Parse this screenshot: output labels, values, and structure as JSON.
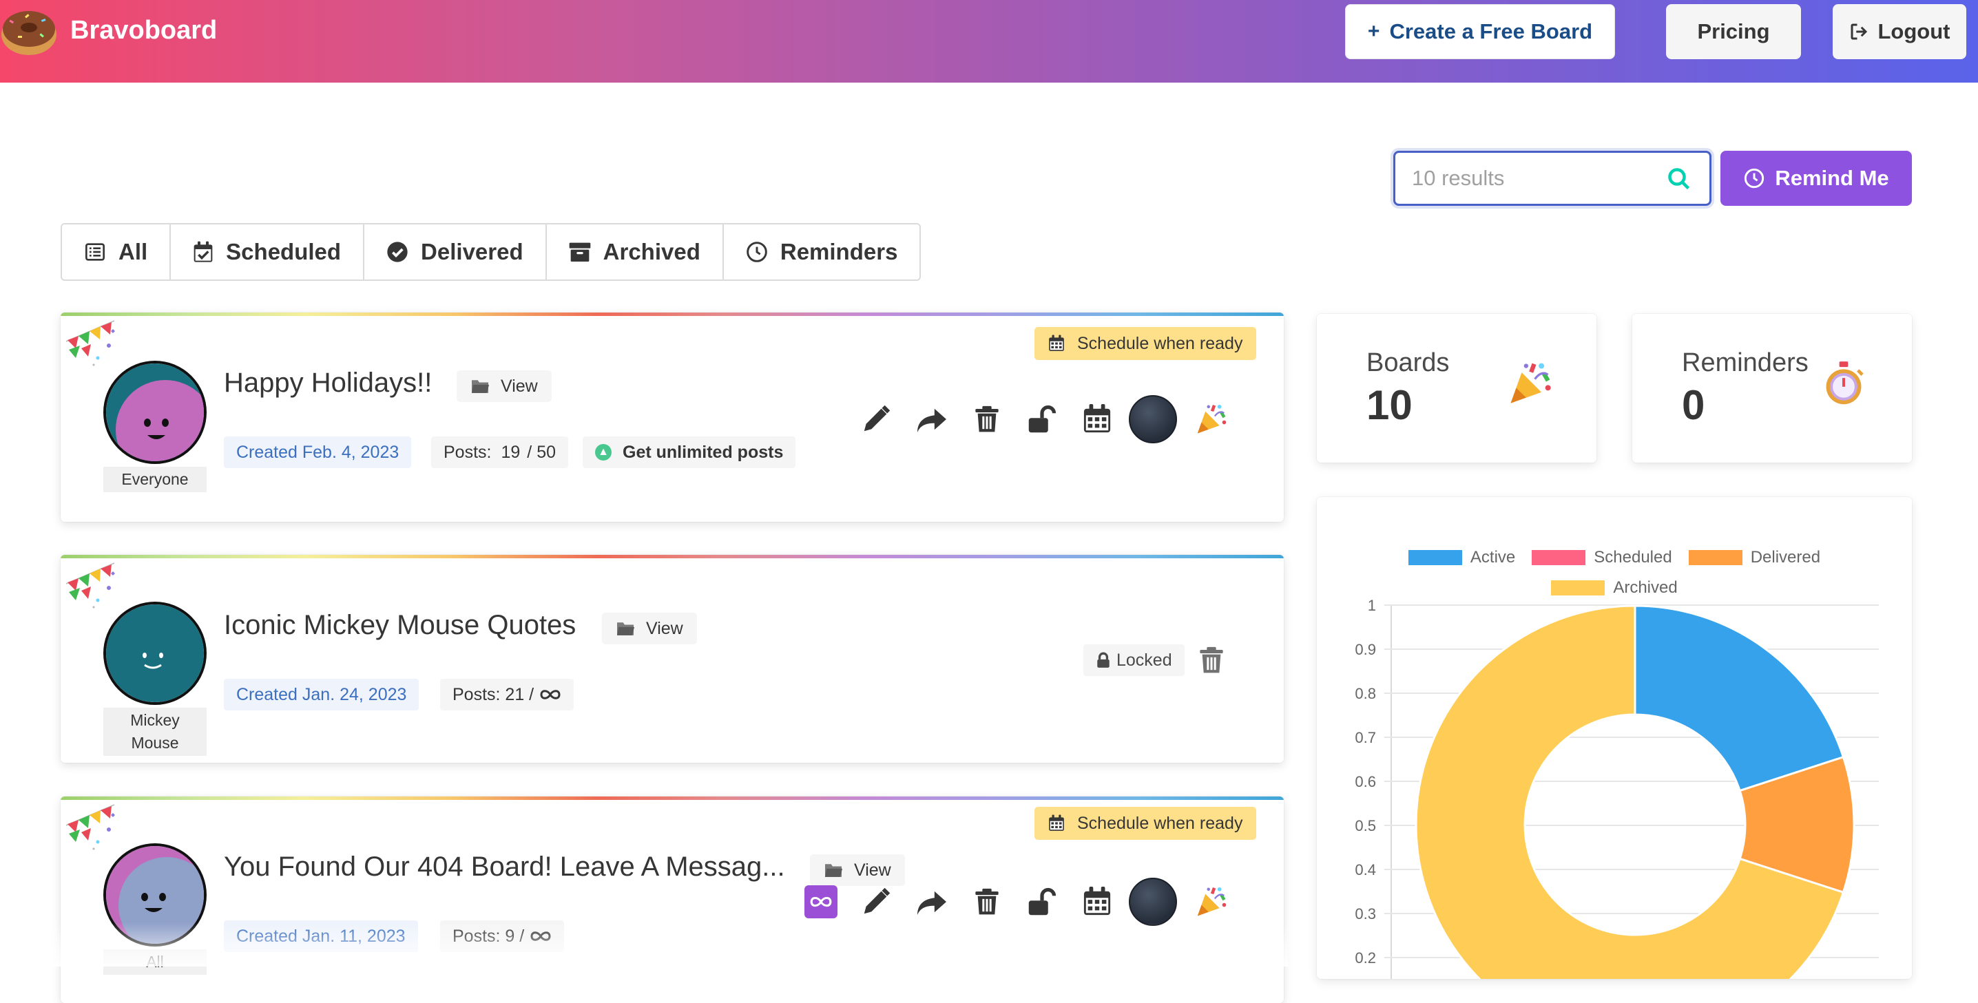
{
  "navbar": {
    "brand": "Bravoboard",
    "create_label": "Create a Free Board",
    "pricing_label": "Pricing",
    "logout_label": "Logout",
    "gradient": [
      "#f4476a",
      "#8e5cc4",
      "#5a63ea"
    ]
  },
  "search": {
    "placeholder": "10 results",
    "value": ""
  },
  "remind_label": "Remind Me",
  "tabs": [
    {
      "label": "All",
      "icon": "list-icon"
    },
    {
      "label": "Scheduled",
      "icon": "calendar-check-icon"
    },
    {
      "label": "Delivered",
      "icon": "check-circle-icon"
    },
    {
      "label": "Archived",
      "icon": "archive-icon"
    },
    {
      "label": "Reminders",
      "icon": "clock-icon"
    }
  ],
  "boards": [
    {
      "title": "Happy Holidays!!",
      "view_label": "View",
      "created": "Created Feb. 4, 2023",
      "posts_label": "Posts:",
      "posts_count": "19",
      "posts_limit": "/ 50",
      "unlimited_label": "Get unlimited posts",
      "avatar_label": "Everyone",
      "schedule_label": "Schedule when ready",
      "avatar_colors": [
        "#1a6f7e",
        "#c26bbd"
      ]
    },
    {
      "title": "Iconic Mickey Mouse Quotes",
      "view_label": "View",
      "created": "Created Jan. 24, 2023",
      "posts_text": "Posts: 21 /",
      "avatar_label": "Mickey Mouse",
      "locked_label": "Locked",
      "avatar_colors": [
        "#1a6f7e"
      ]
    },
    {
      "title": "You Found Our 404 Board! Leave A Messag...",
      "view_label": "View",
      "created": "Created Jan. 11, 2023",
      "posts_text": "Posts: 9 /",
      "avatar_label": "All",
      "schedule_label": "Schedule when ready",
      "avatar_colors": [
        "#c26bbd",
        "#8fa0c9"
      ]
    }
  ],
  "stats": {
    "boards_label": "Boards",
    "boards_value": "10",
    "reminders_label": "Reminders",
    "reminders_value": "0"
  },
  "chart_data": {
    "type": "pie",
    "subtype": "doughnut",
    "categories": [
      "Active",
      "Scheduled",
      "Delivered",
      "Archived"
    ],
    "values": [
      2,
      0,
      1,
      7
    ],
    "colors": [
      "#36a2eb",
      "#ff6384",
      "#ff9f40",
      "#ffcd56"
    ],
    "legend": "top",
    "y_ticks": [
      "1",
      "0.9",
      "0.8",
      "0.7",
      "0.6",
      "0.5",
      "0.4",
      "0.3",
      "0.2"
    ],
    "ylim": [
      0,
      1
    ],
    "grid": true
  }
}
